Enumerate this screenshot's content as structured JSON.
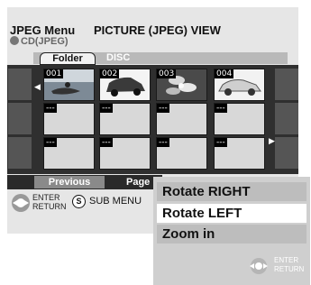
{
  "header": {
    "menu_name": "JPEG Menu",
    "view_title": "PICTURE (JPEG) VIEW",
    "media": "CD(JPEG)"
  },
  "tabs": [
    {
      "label": "Folder",
      "selected": true
    },
    {
      "label": "DISC",
      "selected": false
    }
  ],
  "thumbnails": [
    {
      "number": "001",
      "content": "photo-jetski"
    },
    {
      "number": "002",
      "content": "photo-car-dark"
    },
    {
      "number": "003",
      "content": "photo-flower"
    },
    {
      "number": "004",
      "content": "photo-car-white"
    },
    {
      "number": "---",
      "content": "empty"
    },
    {
      "number": "---",
      "content": "empty"
    },
    {
      "number": "---",
      "content": "empty"
    },
    {
      "number": "---",
      "content": "empty"
    },
    {
      "number": "---",
      "content": "empty"
    },
    {
      "number": "---",
      "content": "empty"
    },
    {
      "number": "---",
      "content": "empty"
    },
    {
      "number": "---",
      "content": "empty"
    }
  ],
  "navigation": {
    "previous_label": "Previous",
    "page_label": "Page"
  },
  "footer": {
    "enter_label": "ENTER",
    "return_label": "RETURN",
    "sub_menu_key": "S",
    "sub_menu_label": "SUB MENU"
  },
  "submenu": {
    "items": [
      {
        "label": "Rotate RIGHT",
        "selected": false
      },
      {
        "label": "Rotate LEFT",
        "selected": true
      },
      {
        "label": "Zoom in",
        "selected": false
      }
    ],
    "enter_label": "ENTER",
    "return_label": "RETURN"
  }
}
